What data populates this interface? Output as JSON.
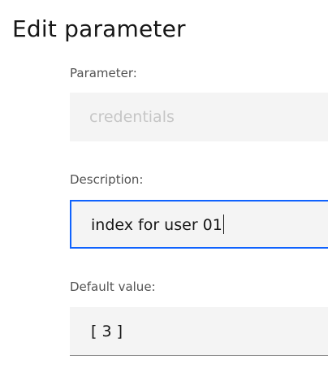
{
  "dialog": {
    "title": "Edit parameter"
  },
  "fields": {
    "parameter": {
      "label": "Parameter:",
      "value": "credentials",
      "state": "disabled"
    },
    "description": {
      "label": "Description:",
      "value": "index for user 01",
      "state": "focused"
    },
    "default_value": {
      "label": "Default value:",
      "value": "[ 3 ]",
      "state": "default"
    }
  },
  "colors": {
    "focus_border": "#0f62fe",
    "field_background": "#f4f4f4",
    "label_text": "#525252",
    "disabled_text": "#c6c6c6"
  }
}
